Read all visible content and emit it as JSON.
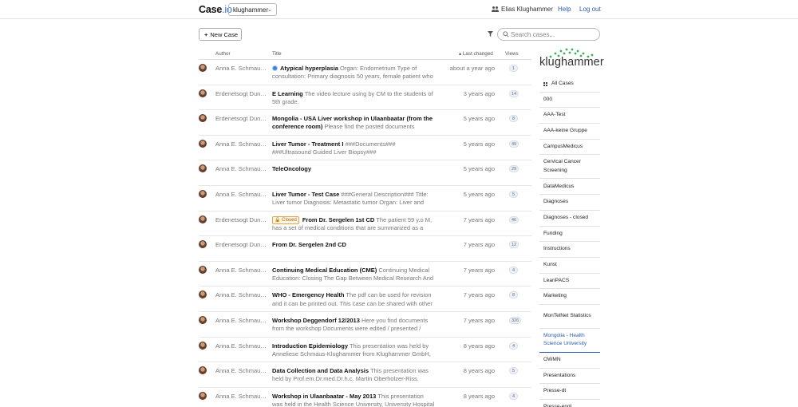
{
  "header": {
    "brand_name": "Case",
    "brand_tld": ".io",
    "org_selected": "klughammer",
    "user_name": "Elias Klughammer",
    "help_label": "Help",
    "logout_label": "Log out"
  },
  "toolbar": {
    "new_case_label": "New Case",
    "search_placeholder": "Search cases..."
  },
  "table": {
    "columns": {
      "author": "Author",
      "title": "Title",
      "changed": "Last changed",
      "views": "Views"
    },
    "rows": [
      {
        "author": "Anna E. Schmau…",
        "title": "Atypical hyperplasia",
        "desc": "Organ: Endometrium Type of consultation: Primary diagnosis 50 years, female patient who",
        "changed": "about a year ago",
        "views": "1",
        "badge": true,
        "closed": false
      },
      {
        "author": "Erdenetsogt Dun…",
        "title": "E Learning",
        "desc": "The video lecture using by CM to the students of 5th grade.",
        "changed": "3 years ago",
        "views": "14",
        "badge": false,
        "closed": false
      },
      {
        "author": "Erdenetsogt Dun…",
        "title": "Mongolia - USA Liver workshop in Ulaanbaatar (from the conference room)",
        "desc": "Please find the posted documents",
        "changed": "5 years ago",
        "views": "8",
        "badge": false,
        "closed": false
      },
      {
        "author": "Anna E. Schmau…",
        "title": "Liver Tumor - Treatment I",
        "desc": "###Documents### ###Ultrasound Guided Liver Biopsy###",
        "changed": "5 years ago",
        "views": "49",
        "badge": false,
        "closed": false
      },
      {
        "author": "Anna E. Schmau…",
        "title": "TeleOncology",
        "desc": "",
        "changed": "5 years ago",
        "views": "29",
        "badge": false,
        "closed": false
      },
      {
        "author": "Anna E. Schmau…",
        "title": "Liver Tumor - Test Case",
        "desc": "###General Description### Title: Liver tumor Diagnosis: Metastatic tumor Organ: Liver and",
        "changed": "5 years ago",
        "views": "5",
        "badge": false,
        "closed": false
      },
      {
        "author": "Erdenetsogt Dun…",
        "title": "From Dr. Sergelen 1st CD",
        "desc": "The patient 59 y.o M, has a set of medical conditions that are summarized as a",
        "changed": "7 years ago",
        "views": "46",
        "badge": false,
        "closed": true
      },
      {
        "author": "Erdenetsogt Dun…",
        "title": "From Dr. Sergelen 2nd CD",
        "desc": "",
        "changed": "7 years ago",
        "views": "12",
        "badge": false,
        "closed": false
      },
      {
        "author": "Anna E. Schmau…",
        "title": "Continuing Medical Education (CME)",
        "desc": "Continuing Medical Education: Closing The Gap Between Medical Research And",
        "changed": "7 years ago",
        "views": "4",
        "badge": false,
        "closed": false
      },
      {
        "author": "Anna E. Schmau…",
        "title": "WHO - Emergency Health",
        "desc": "The pdf can be used for revision and it can be printed out. This case can be shared with other",
        "changed": "7 years ago",
        "views": "8",
        "badge": false,
        "closed": false
      },
      {
        "author": "Anna E. Schmau…",
        "title": "Workshop Deggendorf 12/2013",
        "desc": "Here you find documents from the workshop Documents were edited / presented /",
        "changed": "7 years ago",
        "views": "326",
        "badge": false,
        "closed": false
      },
      {
        "author": "Anna E. Schmau…",
        "title": "Introduction Epidemiology",
        "desc": "This presentation was held by Anneliese Schmaus-Klughammer from Klughammer GmbH,",
        "changed": "8 years ago",
        "views": "4",
        "badge": false,
        "closed": false
      },
      {
        "author": "Anna E. Schmau…",
        "title": "Data Collection and Data Analysis",
        "desc": "This presentation was held by Prof.em.Dr.med.Dr.h.c. Martin Oberholzer-Riss.",
        "changed": "8 years ago",
        "views": "5",
        "badge": false,
        "closed": false
      },
      {
        "author": "Anna E. Schmau…",
        "title": "Workshop in Ulaanbaatar - May 2013",
        "desc": "This presentation was held in the Health Science University, University Hospital",
        "changed": "8 years ago",
        "views": "4",
        "badge": false,
        "closed": false
      }
    ],
    "closed_label": "Closed"
  },
  "sidebar": {
    "logo_text": "klughammer",
    "items": [
      {
        "label": "All Cases",
        "active": false,
        "icon": true
      },
      {
        "label": "000",
        "active": false
      },
      {
        "label": "AAA-Test",
        "active": false
      },
      {
        "label": "AAA-keine Gruppe",
        "active": false
      },
      {
        "label": "CampusMedicus",
        "active": false
      },
      {
        "label": "Cervical Cancer Screening",
        "active": false
      },
      {
        "label": "DataMedicus",
        "active": false
      },
      {
        "label": "Diagnoses",
        "active": false
      },
      {
        "label": "Diagnoses - closed",
        "active": false
      },
      {
        "label": "Funding",
        "active": false
      },
      {
        "label": "Instructions",
        "active": false
      },
      {
        "label": "Kunst",
        "active": false
      },
      {
        "label": "LeanPACS",
        "active": false
      },
      {
        "label": "Marketing",
        "active": false
      },
      {
        "label": "MonTelNet Statistics",
        "active": false
      },
      {
        "label": "Mongolia - Health Science University",
        "active": true
      },
      {
        "label": "OWMN",
        "active": false
      },
      {
        "label": "Presentations",
        "active": false
      },
      {
        "label": "Presse-dt",
        "active": false
      },
      {
        "label": "Presse-engl",
        "active": false
      }
    ]
  },
  "colors": {
    "link": "#2a5db0",
    "logo_green": "#3fae5a",
    "badge_blue": "#3b82e0"
  }
}
